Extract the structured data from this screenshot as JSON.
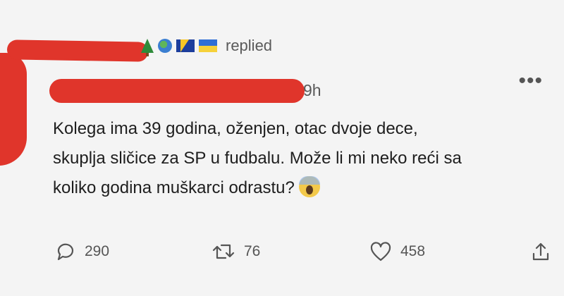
{
  "header": {
    "replied_label": "replied"
  },
  "tweet": {
    "time": "9h",
    "more_label": "•••",
    "lines": [
      "Kolega ima 39 godina, oženjen, otac dvoje dece,",
      "skuplja sličice za SP u fudbalu. Može li mi neko reći sa",
      "koliko godina muškarci odrastu?"
    ],
    "emoji": "face-screaming-in-fear"
  },
  "actions": {
    "replies": "290",
    "retweets": "76",
    "likes": "458"
  },
  "icons": [
    "tree-icon",
    "globe-icon",
    "flag-bosnia-icon",
    "flag-ukraine-icon",
    "reply-icon",
    "retweet-icon",
    "heart-icon",
    "share-icon",
    "more-icon"
  ],
  "colors": {
    "redaction": "#e0352b",
    "background": "#f4f4f4",
    "text": "#1e1e1e",
    "muted": "#5a5a5a"
  }
}
